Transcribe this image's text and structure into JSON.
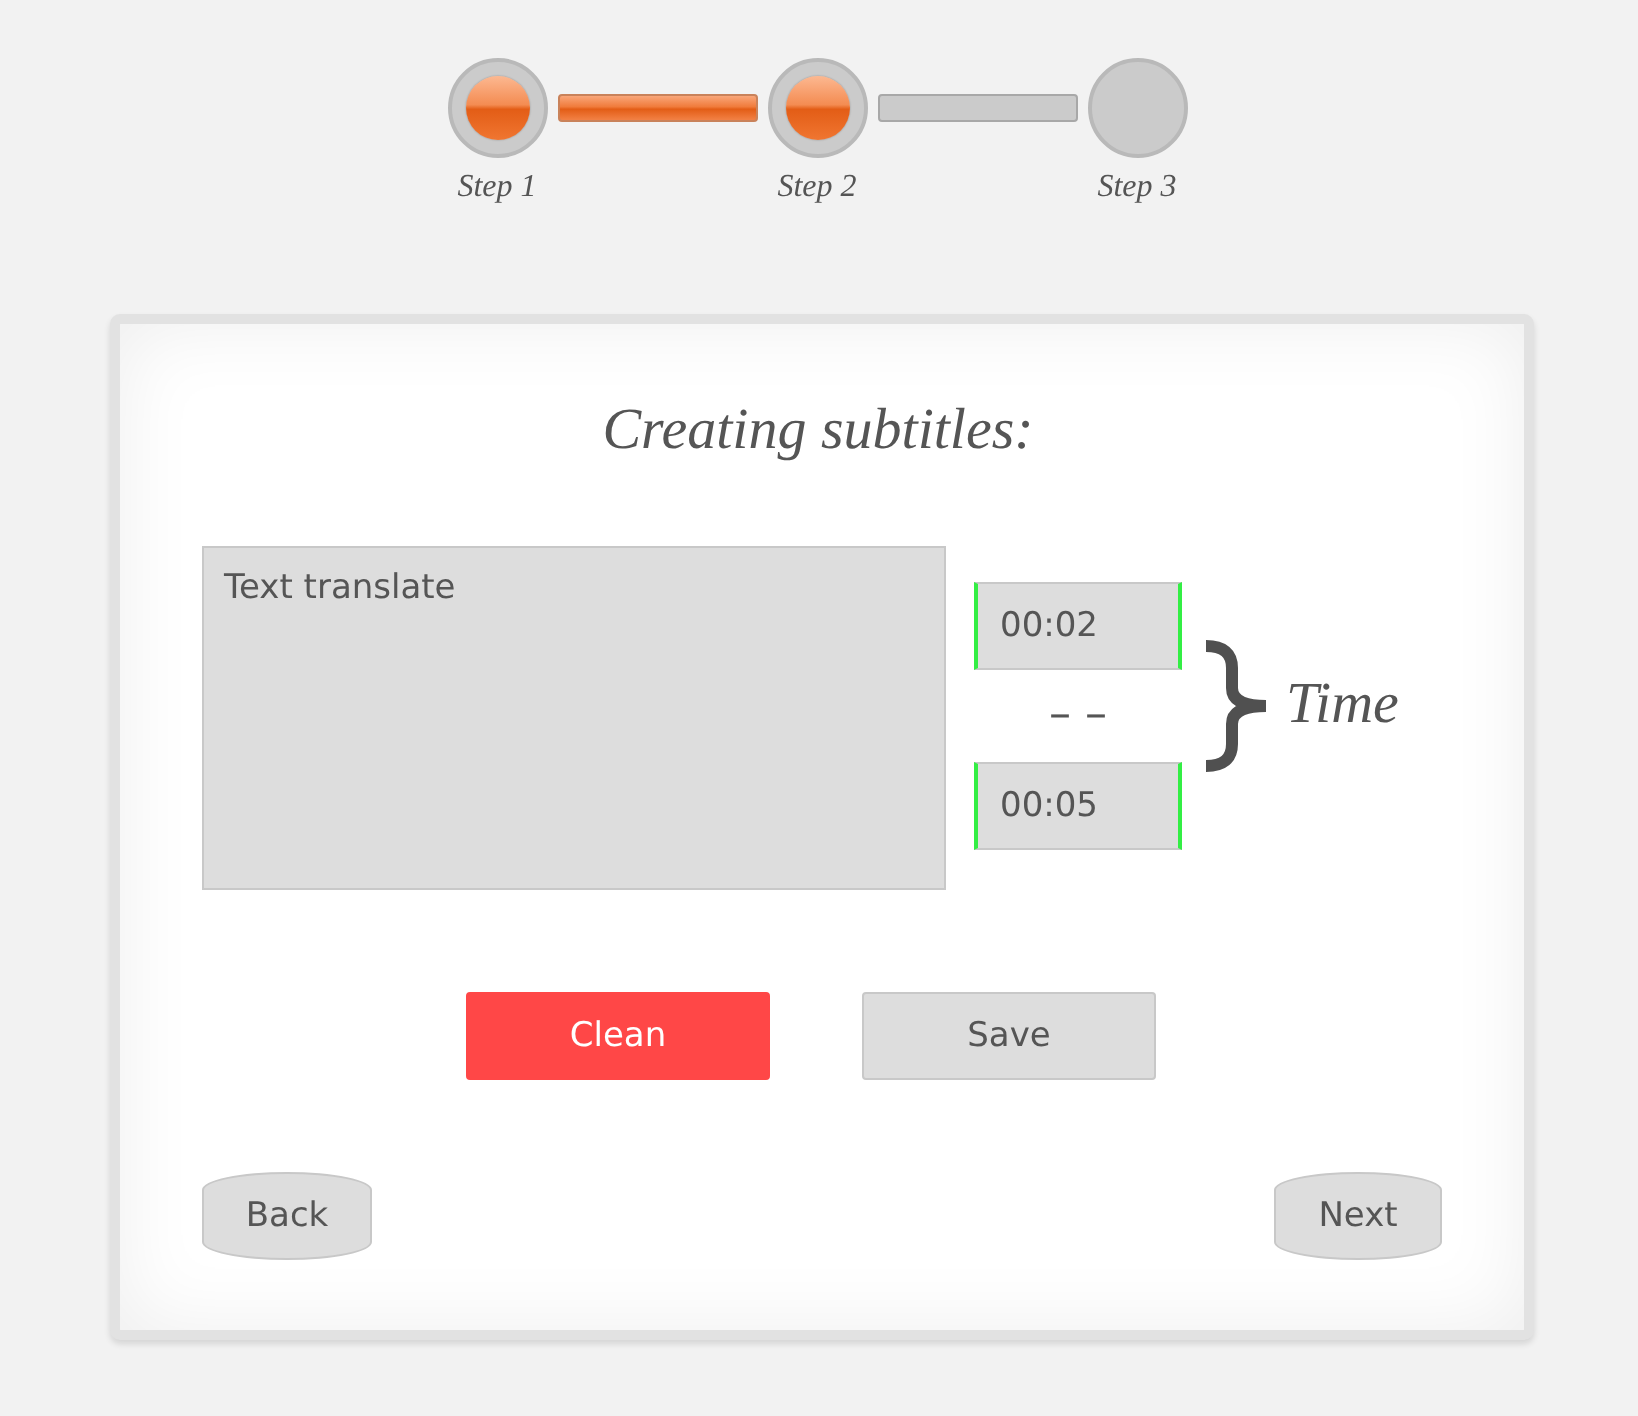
{
  "stepper": {
    "steps": [
      {
        "label": "Step 1",
        "done": true
      },
      {
        "label": "Step 2",
        "done": true
      },
      {
        "label": "Step 3",
        "done": false
      }
    ]
  },
  "card": {
    "title": "Creating subtitles:",
    "subtitle_text": {
      "placeholder": "Text translate"
    },
    "time": {
      "start": "00:02",
      "separator": "– –",
      "end": "00:05",
      "label": "Time"
    },
    "actions": [
      {
        "label": "Clean",
        "kind": "primary"
      },
      {
        "label": "Save",
        "kind": "secondary"
      }
    ],
    "navigation": {
      "back": "Back",
      "next": "Next"
    }
  }
}
